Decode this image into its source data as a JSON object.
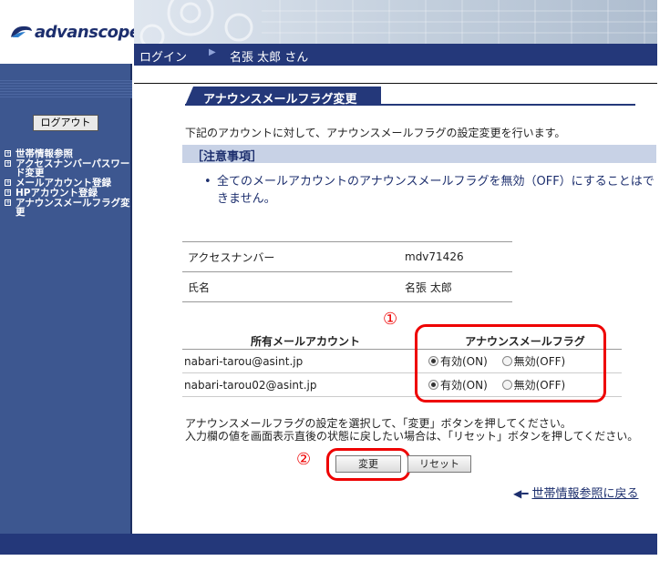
{
  "header": {
    "logo_text": "advanscope",
    "login_label": "ログイン",
    "separator": "▶",
    "user_name": "名張 太郎 さん"
  },
  "sidebar": {
    "logout_label": "ログアウト",
    "items": [
      {
        "label": "世帯情報参照"
      },
      {
        "label": "アクセスナンバーパスワード変更"
      },
      {
        "label": "メールアカウント登録"
      },
      {
        "label": "HPアカウント登録"
      },
      {
        "label": "アナウンスメールフラグ変更"
      }
    ]
  },
  "main": {
    "title": "アナウンスメールフラグ変更",
    "intro": "下記のアカウントに対して、アナウンスメールフラグの設定変更を行います。",
    "notice_heading": "［注意事項］",
    "notice_text": "全てのメールアカウントのアナウンスメールフラグを無効（OFF）にすることはできません。",
    "info": [
      {
        "label": "アクセスナンバー",
        "value": "mdv71426"
      },
      {
        "label": "氏名",
        "value": "名張 太郎"
      }
    ],
    "accounts_header": {
      "account": "所有メールアカウント",
      "flag": "アナウンスメールフラグ"
    },
    "accounts": [
      {
        "address": "nabari-tarou@asint.jp",
        "on_label": "有効(ON)",
        "off_label": "無効(OFF)",
        "selected": "on"
      },
      {
        "address": "nabari-tarou02@asint.jp",
        "on_label": "有効(ON)",
        "off_label": "無効(OFF)",
        "selected": "on"
      }
    ],
    "help_line1": "アナウンスメールフラグの設定を選択して、「変更」ボタンを押してください。",
    "help_line2": "入力欄の値を画面表示直後の状態に戻したい場合は、「リセット」ボタンを押してください。",
    "change_button": "変更",
    "reset_button": "リセット",
    "back_link": "世帯情報参照に戻る",
    "annotation_1": "①",
    "annotation_2": "②"
  },
  "colors": {
    "navy": "#24387a",
    "sidebar": "#3d5790",
    "highlight": "#e00000"
  }
}
